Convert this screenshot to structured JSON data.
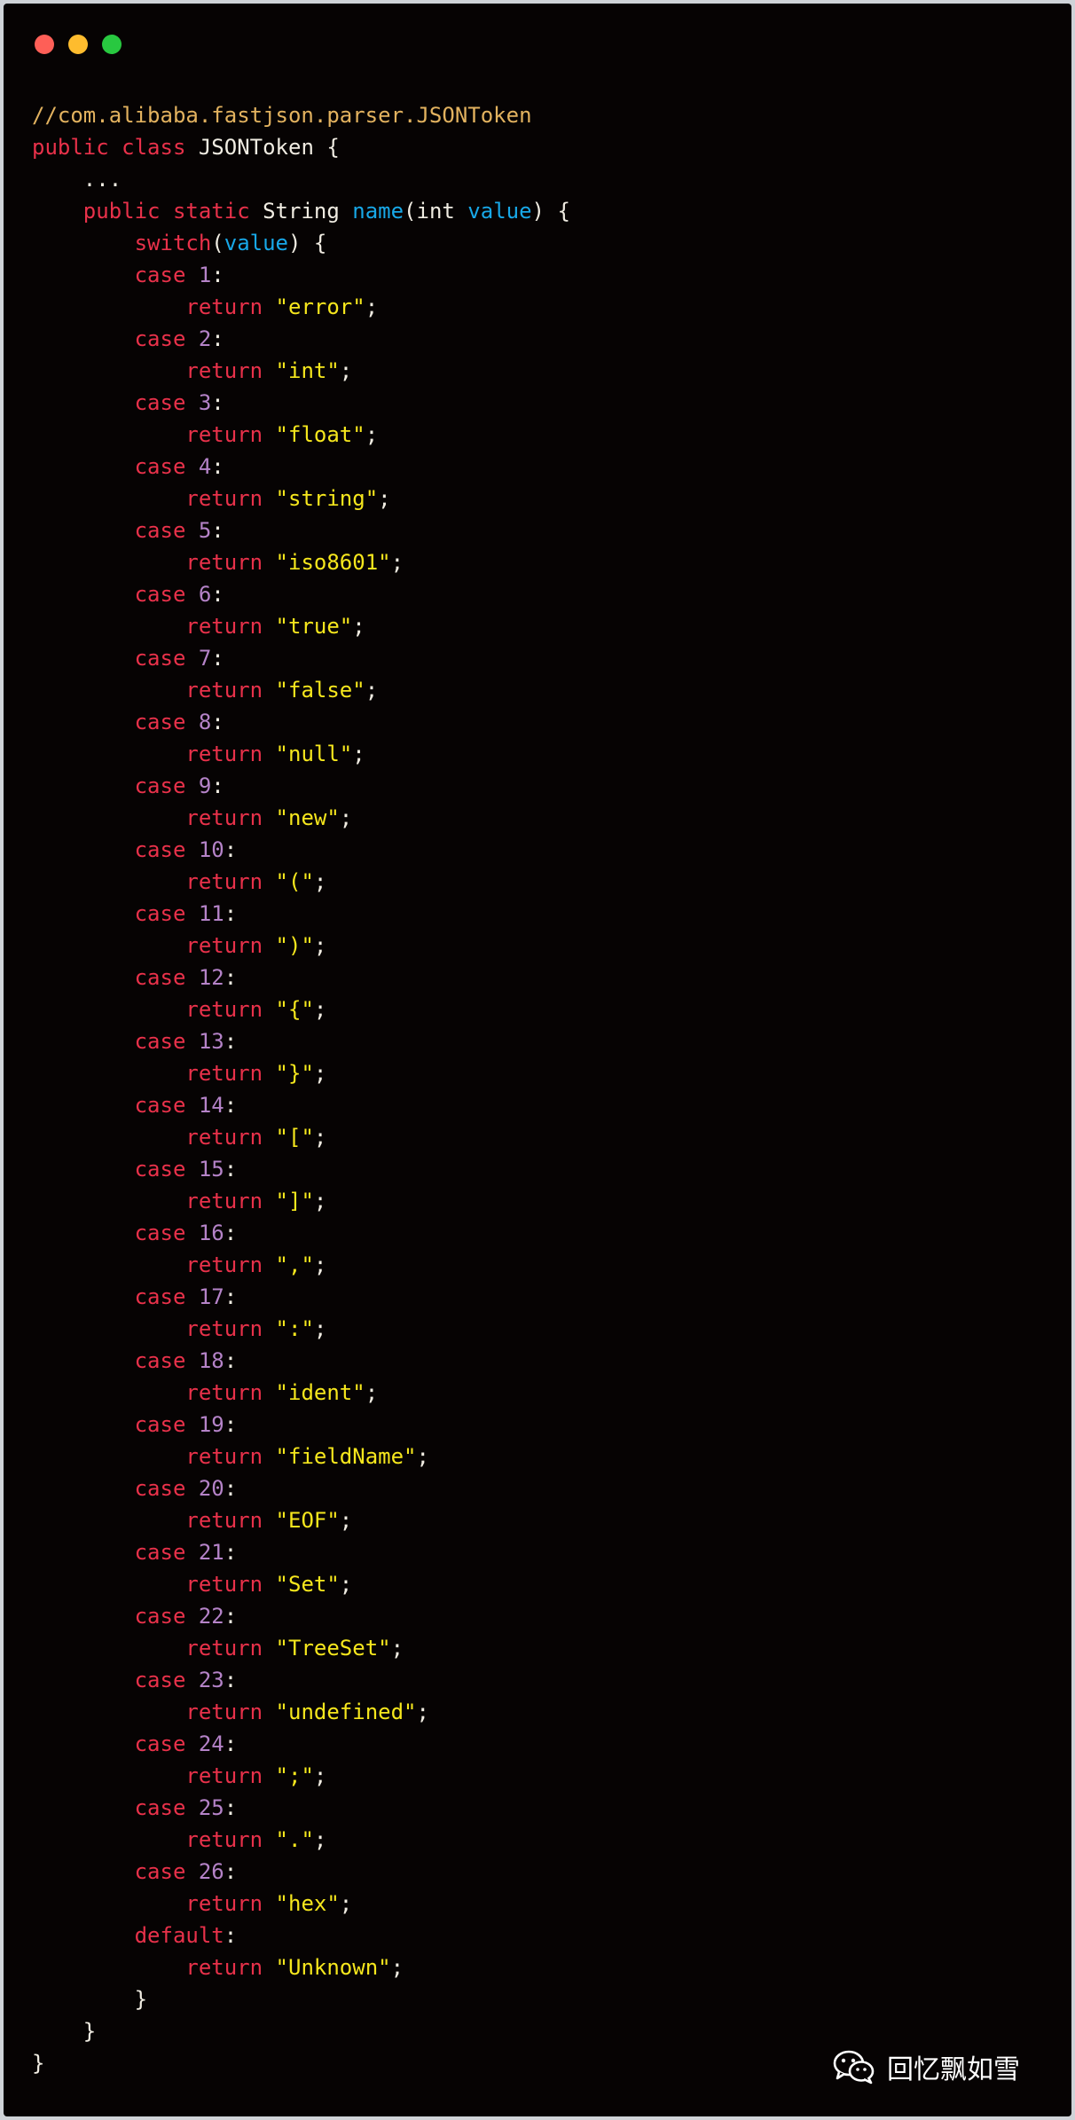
{
  "window": {
    "controls": [
      {
        "name": "close",
        "color": "#fe5f57"
      },
      {
        "name": "minimize",
        "color": "#febc2e"
      },
      {
        "name": "maximize",
        "color": "#28c840"
      }
    ]
  },
  "code": {
    "lines": [
      [
        {
          "t": "//com.alibaba.fastjson.parser.JSONToken",
          "c": "comment"
        }
      ],
      [
        {
          "t": "public class ",
          "c": "keyword"
        },
        {
          "t": "JSONToken {",
          "c": "plain"
        }
      ],
      [
        {
          "t": "    ...",
          "c": "plain"
        }
      ],
      [
        {
          "t": "    public static ",
          "c": "keyword"
        },
        {
          "t": "String ",
          "c": "plain"
        },
        {
          "t": "name",
          "c": "func"
        },
        {
          "t": "(int ",
          "c": "plain"
        },
        {
          "t": "value",
          "c": "param"
        },
        {
          "t": ") {",
          "c": "plain"
        }
      ],
      [
        {
          "t": "        switch",
          "c": "keyword"
        },
        {
          "t": "(",
          "c": "plain"
        },
        {
          "t": "value",
          "c": "param"
        },
        {
          "t": ") {",
          "c": "plain"
        }
      ],
      [
        {
          "t": "        case ",
          "c": "keyword"
        },
        {
          "t": "1",
          "c": "number"
        },
        {
          "t": ":",
          "c": "plain"
        }
      ],
      [
        {
          "t": "            return ",
          "c": "keyword"
        },
        {
          "t": "\"error\"",
          "c": "string"
        },
        {
          "t": ";",
          "c": "plain"
        }
      ],
      [
        {
          "t": "        case ",
          "c": "keyword"
        },
        {
          "t": "2",
          "c": "number"
        },
        {
          "t": ":",
          "c": "plain"
        }
      ],
      [
        {
          "t": "            return ",
          "c": "keyword"
        },
        {
          "t": "\"int\"",
          "c": "string"
        },
        {
          "t": ";",
          "c": "plain"
        }
      ],
      [
        {
          "t": "        case ",
          "c": "keyword"
        },
        {
          "t": "3",
          "c": "number"
        },
        {
          "t": ":",
          "c": "plain"
        }
      ],
      [
        {
          "t": "            return ",
          "c": "keyword"
        },
        {
          "t": "\"float\"",
          "c": "string"
        },
        {
          "t": ";",
          "c": "plain"
        }
      ],
      [
        {
          "t": "        case ",
          "c": "keyword"
        },
        {
          "t": "4",
          "c": "number"
        },
        {
          "t": ":",
          "c": "plain"
        }
      ],
      [
        {
          "t": "            return ",
          "c": "keyword"
        },
        {
          "t": "\"string\"",
          "c": "string"
        },
        {
          "t": ";",
          "c": "plain"
        }
      ],
      [
        {
          "t": "        case ",
          "c": "keyword"
        },
        {
          "t": "5",
          "c": "number"
        },
        {
          "t": ":",
          "c": "plain"
        }
      ],
      [
        {
          "t": "            return ",
          "c": "keyword"
        },
        {
          "t": "\"iso8601\"",
          "c": "string"
        },
        {
          "t": ";",
          "c": "plain"
        }
      ],
      [
        {
          "t": "        case ",
          "c": "keyword"
        },
        {
          "t": "6",
          "c": "number"
        },
        {
          "t": ":",
          "c": "plain"
        }
      ],
      [
        {
          "t": "            return ",
          "c": "keyword"
        },
        {
          "t": "\"true\"",
          "c": "string"
        },
        {
          "t": ";",
          "c": "plain"
        }
      ],
      [
        {
          "t": "        case ",
          "c": "keyword"
        },
        {
          "t": "7",
          "c": "number"
        },
        {
          "t": ":",
          "c": "plain"
        }
      ],
      [
        {
          "t": "            return ",
          "c": "keyword"
        },
        {
          "t": "\"false\"",
          "c": "string"
        },
        {
          "t": ";",
          "c": "plain"
        }
      ],
      [
        {
          "t": "        case ",
          "c": "keyword"
        },
        {
          "t": "8",
          "c": "number"
        },
        {
          "t": ":",
          "c": "plain"
        }
      ],
      [
        {
          "t": "            return ",
          "c": "keyword"
        },
        {
          "t": "\"null\"",
          "c": "string"
        },
        {
          "t": ";",
          "c": "plain"
        }
      ],
      [
        {
          "t": "        case ",
          "c": "keyword"
        },
        {
          "t": "9",
          "c": "number"
        },
        {
          "t": ":",
          "c": "plain"
        }
      ],
      [
        {
          "t": "            return ",
          "c": "keyword"
        },
        {
          "t": "\"new\"",
          "c": "string"
        },
        {
          "t": ";",
          "c": "plain"
        }
      ],
      [
        {
          "t": "        case ",
          "c": "keyword"
        },
        {
          "t": "10",
          "c": "number"
        },
        {
          "t": ":",
          "c": "plain"
        }
      ],
      [
        {
          "t": "            return ",
          "c": "keyword"
        },
        {
          "t": "\"(\"",
          "c": "string"
        },
        {
          "t": ";",
          "c": "plain"
        }
      ],
      [
        {
          "t": "        case ",
          "c": "keyword"
        },
        {
          "t": "11",
          "c": "number"
        },
        {
          "t": ":",
          "c": "plain"
        }
      ],
      [
        {
          "t": "            return ",
          "c": "keyword"
        },
        {
          "t": "\")\"",
          "c": "string"
        },
        {
          "t": ";",
          "c": "plain"
        }
      ],
      [
        {
          "t": "        case ",
          "c": "keyword"
        },
        {
          "t": "12",
          "c": "number"
        },
        {
          "t": ":",
          "c": "plain"
        }
      ],
      [
        {
          "t": "            return ",
          "c": "keyword"
        },
        {
          "t": "\"{\"",
          "c": "string"
        },
        {
          "t": ";",
          "c": "plain"
        }
      ],
      [
        {
          "t": "        case ",
          "c": "keyword"
        },
        {
          "t": "13",
          "c": "number"
        },
        {
          "t": ":",
          "c": "plain"
        }
      ],
      [
        {
          "t": "            return ",
          "c": "keyword"
        },
        {
          "t": "\"}\"",
          "c": "string"
        },
        {
          "t": ";",
          "c": "plain"
        }
      ],
      [
        {
          "t": "        case ",
          "c": "keyword"
        },
        {
          "t": "14",
          "c": "number"
        },
        {
          "t": ":",
          "c": "plain"
        }
      ],
      [
        {
          "t": "            return ",
          "c": "keyword"
        },
        {
          "t": "\"[\"",
          "c": "string"
        },
        {
          "t": ";",
          "c": "plain"
        }
      ],
      [
        {
          "t": "        case ",
          "c": "keyword"
        },
        {
          "t": "15",
          "c": "number"
        },
        {
          "t": ":",
          "c": "plain"
        }
      ],
      [
        {
          "t": "            return ",
          "c": "keyword"
        },
        {
          "t": "\"]\"",
          "c": "string"
        },
        {
          "t": ";",
          "c": "plain"
        }
      ],
      [
        {
          "t": "        case ",
          "c": "keyword"
        },
        {
          "t": "16",
          "c": "number"
        },
        {
          "t": ":",
          "c": "plain"
        }
      ],
      [
        {
          "t": "            return ",
          "c": "keyword"
        },
        {
          "t": "\",\"",
          "c": "string"
        },
        {
          "t": ";",
          "c": "plain"
        }
      ],
      [
        {
          "t": "        case ",
          "c": "keyword"
        },
        {
          "t": "17",
          "c": "number"
        },
        {
          "t": ":",
          "c": "plain"
        }
      ],
      [
        {
          "t": "            return ",
          "c": "keyword"
        },
        {
          "t": "\":\"",
          "c": "string"
        },
        {
          "t": ";",
          "c": "plain"
        }
      ],
      [
        {
          "t": "        case ",
          "c": "keyword"
        },
        {
          "t": "18",
          "c": "number"
        },
        {
          "t": ":",
          "c": "plain"
        }
      ],
      [
        {
          "t": "            return ",
          "c": "keyword"
        },
        {
          "t": "\"ident\"",
          "c": "string"
        },
        {
          "t": ";",
          "c": "plain"
        }
      ],
      [
        {
          "t": "        case ",
          "c": "keyword"
        },
        {
          "t": "19",
          "c": "number"
        },
        {
          "t": ":",
          "c": "plain"
        }
      ],
      [
        {
          "t": "            return ",
          "c": "keyword"
        },
        {
          "t": "\"fieldName\"",
          "c": "string"
        },
        {
          "t": ";",
          "c": "plain"
        }
      ],
      [
        {
          "t": "        case ",
          "c": "keyword"
        },
        {
          "t": "20",
          "c": "number"
        },
        {
          "t": ":",
          "c": "plain"
        }
      ],
      [
        {
          "t": "            return ",
          "c": "keyword"
        },
        {
          "t": "\"EOF\"",
          "c": "string"
        },
        {
          "t": ";",
          "c": "plain"
        }
      ],
      [
        {
          "t": "        case ",
          "c": "keyword"
        },
        {
          "t": "21",
          "c": "number"
        },
        {
          "t": ":",
          "c": "plain"
        }
      ],
      [
        {
          "t": "            return ",
          "c": "keyword"
        },
        {
          "t": "\"Set\"",
          "c": "string"
        },
        {
          "t": ";",
          "c": "plain"
        }
      ],
      [
        {
          "t": "        case ",
          "c": "keyword"
        },
        {
          "t": "22",
          "c": "number"
        },
        {
          "t": ":",
          "c": "plain"
        }
      ],
      [
        {
          "t": "            return ",
          "c": "keyword"
        },
        {
          "t": "\"TreeSet\"",
          "c": "string"
        },
        {
          "t": ";",
          "c": "plain"
        }
      ],
      [
        {
          "t": "        case ",
          "c": "keyword"
        },
        {
          "t": "23",
          "c": "number"
        },
        {
          "t": ":",
          "c": "plain"
        }
      ],
      [
        {
          "t": "            return ",
          "c": "keyword"
        },
        {
          "t": "\"undefined\"",
          "c": "string"
        },
        {
          "t": ";",
          "c": "plain"
        }
      ],
      [
        {
          "t": "        case ",
          "c": "keyword"
        },
        {
          "t": "24",
          "c": "number"
        },
        {
          "t": ":",
          "c": "plain"
        }
      ],
      [
        {
          "t": "            return ",
          "c": "keyword"
        },
        {
          "t": "\";\"",
          "c": "string"
        },
        {
          "t": ";",
          "c": "plain"
        }
      ],
      [
        {
          "t": "        case ",
          "c": "keyword"
        },
        {
          "t": "25",
          "c": "number"
        },
        {
          "t": ":",
          "c": "plain"
        }
      ],
      [
        {
          "t": "            return ",
          "c": "keyword"
        },
        {
          "t": "\".\"",
          "c": "string"
        },
        {
          "t": ";",
          "c": "plain"
        }
      ],
      [
        {
          "t": "        case ",
          "c": "keyword"
        },
        {
          "t": "26",
          "c": "number"
        },
        {
          "t": ":",
          "c": "plain"
        }
      ],
      [
        {
          "t": "            return ",
          "c": "keyword"
        },
        {
          "t": "\"hex\"",
          "c": "string"
        },
        {
          "t": ";",
          "c": "plain"
        }
      ],
      [
        {
          "t": "        default",
          "c": "keyword"
        },
        {
          "t": ":",
          "c": "plain"
        }
      ],
      [
        {
          "t": "            return ",
          "c": "keyword"
        },
        {
          "t": "\"Unknown\"",
          "c": "string"
        },
        {
          "t": ";",
          "c": "plain"
        }
      ],
      [
        {
          "t": "        }",
          "c": "plain"
        }
      ],
      [
        {
          "t": "    }",
          "c": "plain"
        }
      ],
      [
        {
          "t": "}",
          "c": "plain"
        }
      ]
    ]
  },
  "watermark": {
    "icon": "wechat-icon",
    "text": "回忆飘如雪"
  }
}
